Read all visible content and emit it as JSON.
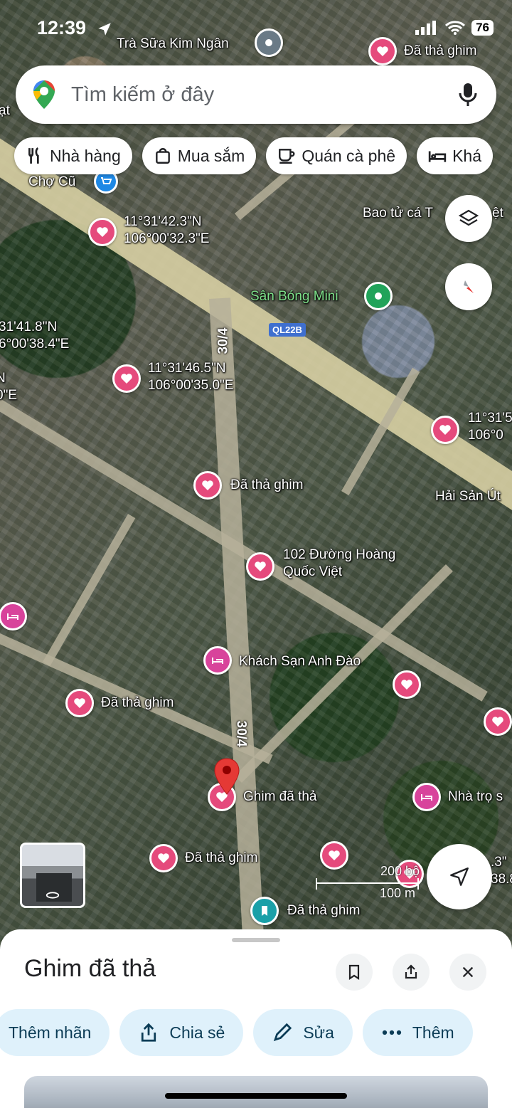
{
  "status": {
    "time": "12:39",
    "battery": "76"
  },
  "search": {
    "placeholder": "Tìm kiếm ở đây"
  },
  "chips": [
    {
      "label": "Nhà hàng",
      "icon": "restaurant-icon"
    },
    {
      "label": "Mua sắm",
      "icon": "shopping-bag-icon"
    },
    {
      "label": "Quán cà phê",
      "icon": "coffee-icon"
    },
    {
      "label": "Khá",
      "icon": "hotel-bed-icon"
    }
  ],
  "map": {
    "places": {
      "tra_sua": "Trà Sữa Kim Ngân",
      "cho_cu": "Chợ Cũ",
      "bao_tu": "Bao tử cá T",
      "bao_tu_end": "ệt",
      "san_bong": "Sân Bóng Mini",
      "hai_san": "Hải Sản Út",
      "hoang_quoc_viet": "102 Đường Hoàng\nQuốc Việt",
      "anh_dao": "Khách Sạn Anh Đào",
      "nha_tro": "Nhà trọ s",
      "ghim_da_tha": "Ghim đã thả",
      "left_edge": "ạt"
    },
    "pins": {
      "top": "Đã thả ghim",
      "middle": "Đã thả ghim",
      "left": "Đã thả ghim",
      "bottom": "Đã thả ghim",
      "saved": "Đã thả ghim"
    },
    "coords": {
      "c1": "11°31'42.3\"N\n106°00'32.3\"E",
      "c2": "31'41.8\"N\n6°00'38.4\"E",
      "c2b": "N\n0\"E",
      "c3": "11°31'46.5\"N\n106°00'35.0\"E",
      "c4": "11°31'5\n106°0",
      "c5": ".3\"\n38.8"
    },
    "roads": {
      "r1": "30/4",
      "r2": "30/4",
      "shield": "QL22B"
    },
    "scale": {
      "imperial": "200 bộ",
      "metric": "100 m"
    }
  },
  "sheet": {
    "title": "Ghim đã thả",
    "actions": [
      {
        "label": "Thêm nhãn",
        "icon": ""
      },
      {
        "label": "Chia sẻ",
        "icon": "share-icon"
      },
      {
        "label": "Sửa",
        "icon": "pencil-icon"
      },
      {
        "label": "Thêm",
        "icon": "more-dots-icon"
      }
    ]
  },
  "colors": {
    "pin_pink": "#e54a7c",
    "pin_red": "#e53935",
    "chip_bg": "#ffffff",
    "action_bg": "#dff1fb"
  }
}
